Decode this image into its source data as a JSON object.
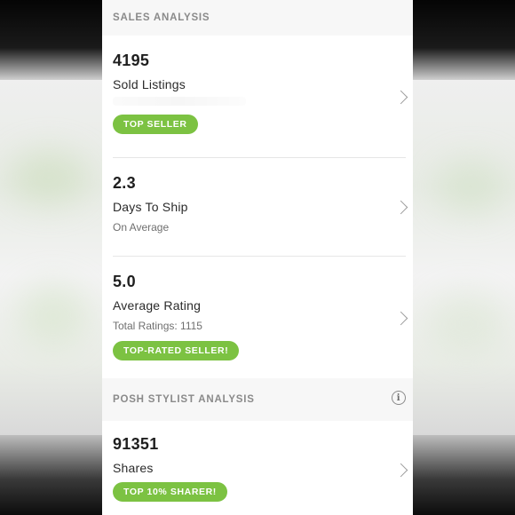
{
  "sales_section": {
    "header": "SALES ANALYSIS"
  },
  "cards": [
    {
      "metric": "4195",
      "title": "Sold Listings",
      "badge": "TOP SELLER"
    },
    {
      "metric": "2.3",
      "title": "Days To Ship",
      "subtitle": "On Average"
    },
    {
      "metric": "5.0",
      "title": "Average Rating",
      "subtitle": "Total Ratings: 1115",
      "badge": "TOP-RATED SELLER!"
    }
  ],
  "stylist_section": {
    "header": "POSH STYLIST ANALYSIS",
    "info_icon": "info-icon"
  },
  "stylist_cards": [
    {
      "metric": "91351",
      "title": "Shares",
      "badge": "TOP 10% SHARER!"
    }
  ],
  "colors": {
    "badge_green": "#7cc242",
    "header_bg": "#f7f7f7"
  }
}
